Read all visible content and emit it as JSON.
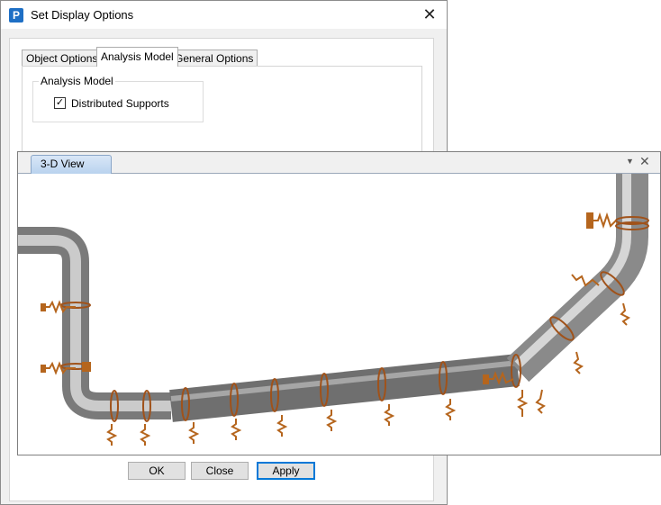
{
  "dialog": {
    "title": "Set Display Options",
    "app_icon_letter": "P",
    "close_glyph": "✕",
    "tabs": [
      {
        "label": "Object Options",
        "active": false
      },
      {
        "label": "Analysis Model",
        "active": true
      },
      {
        "label": "General Options",
        "active": false
      }
    ],
    "group_title": "Analysis Model",
    "checkbox": {
      "label": "Distributed Supports",
      "checked": true,
      "mark": "✓"
    },
    "buttons": {
      "ok": "OK",
      "close": "Close",
      "apply": "Apply"
    }
  },
  "view": {
    "tab_label": "3-D View",
    "dropdown_glyph": "▼",
    "close_glyph": "✕"
  },
  "colors": {
    "pipe_gray": "#9a9a9a",
    "pipe_light": "#d9d9d9",
    "support_brown": "#b5651d",
    "accent_blue": "#0078d7"
  }
}
